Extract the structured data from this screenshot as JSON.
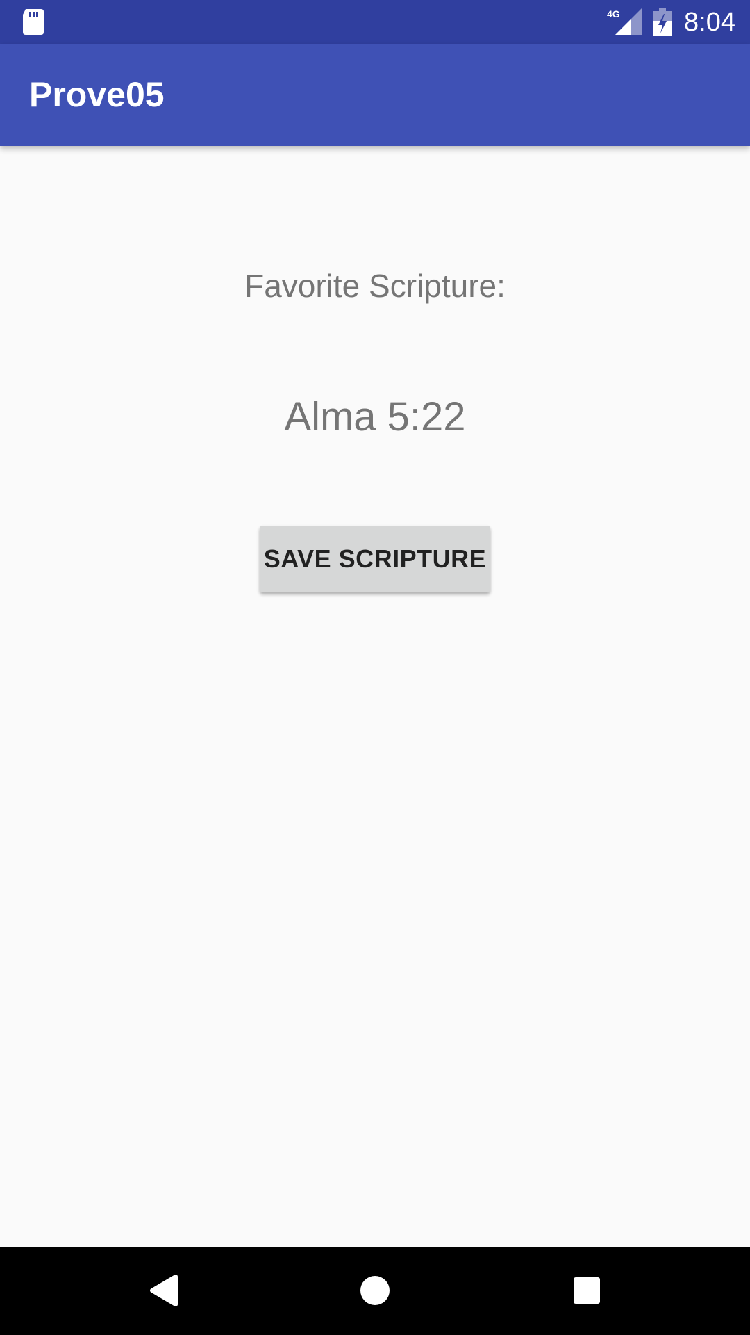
{
  "status_bar": {
    "time": "8:04",
    "network_label": "4G",
    "icons": [
      "sd-card-icon",
      "cellular-signal-icon",
      "battery-charging-icon"
    ]
  },
  "app_bar": {
    "title": "Prove05"
  },
  "main": {
    "label": "Favorite Scripture:",
    "scripture": "Alma 5:22",
    "save_button_label": "SAVE SCRIPTURE"
  },
  "nav_bar": {
    "icons": [
      "back-icon",
      "home-icon",
      "recents-icon"
    ]
  },
  "colors": {
    "status_bar": "#303f9f",
    "app_bar": "#3f51b5",
    "background": "#fafafa",
    "button": "#d6d7d7",
    "text_secondary": "#757575"
  }
}
